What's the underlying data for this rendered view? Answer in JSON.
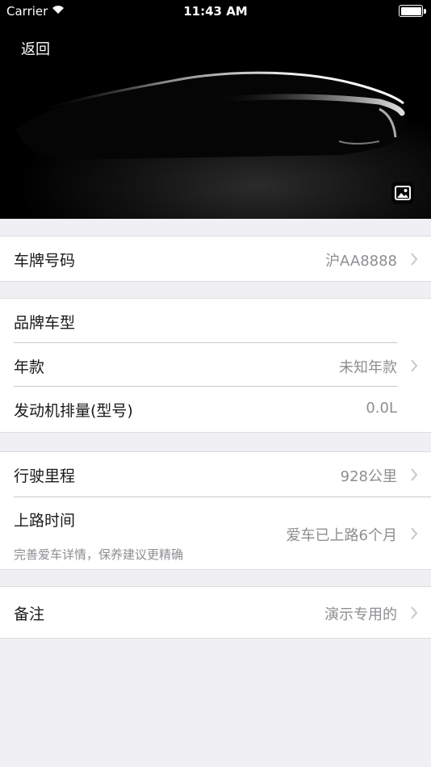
{
  "status_bar": {
    "carrier": "Carrier",
    "time": "11:43 AM"
  },
  "header": {
    "back_label": "返回",
    "gallery_icon": "photo-icon"
  },
  "sections": {
    "plate": {
      "label": "车牌号码",
      "value": "沪AA8888"
    },
    "brand": {
      "label": "品牌车型"
    },
    "year": {
      "label": "年款",
      "value": "未知年款"
    },
    "engine": {
      "label": "发动机排量(型号)",
      "value": "0.0L"
    },
    "mileage": {
      "label": "行驶里程",
      "value": "928公里"
    },
    "road_time": {
      "label": "上路时间",
      "value": "爱车已上路6个月",
      "hint": "完善爱车详情，保养建议更精确"
    },
    "remark": {
      "label": "备注",
      "value": "演示专用的"
    }
  },
  "colors": {
    "background": "#efeff4",
    "value_text": "#8e8e93",
    "label_text": "#1a1a1a"
  }
}
